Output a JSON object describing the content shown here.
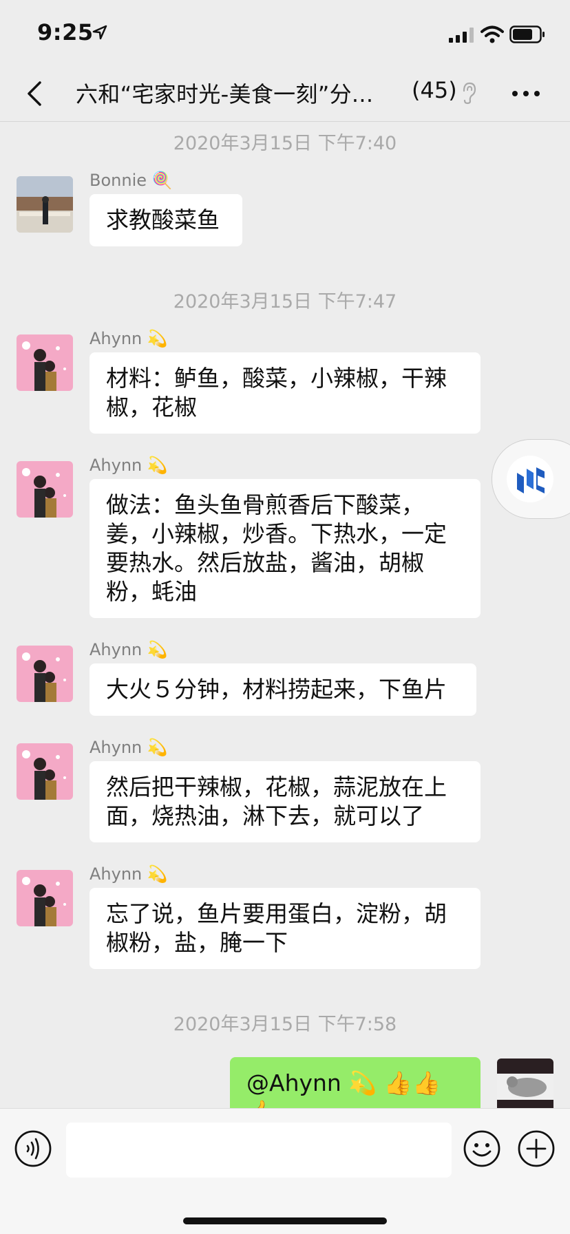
{
  "status_bar": {
    "time": "9:25"
  },
  "nav": {
    "title": "六和“宅家时光-美食一刻”分...",
    "member_count": "(45)"
  },
  "messages": [
    {
      "type": "timestamp",
      "text": "2020年3月15日 下午7:40"
    },
    {
      "type": "text",
      "sender": "Bonnie 🍭",
      "text": "求教酸菜鱼"
    },
    {
      "type": "timestamp",
      "text": "2020年3月15日 下午7:47"
    },
    {
      "type": "text",
      "sender": "Ahynn 💫",
      "text": "材料：鲈鱼，酸菜，小辣椒，干辣椒，花椒"
    },
    {
      "type": "text",
      "sender": "Ahynn 💫",
      "text": "做法：鱼头鱼骨煎香后下酸菜，姜，小辣椒，炒香。下热水，一定要热水。然后放盐，酱油，胡椒粉，蚝油"
    },
    {
      "type": "text",
      "sender": "Ahynn 💫",
      "text": "大火５分钟，材料捞起来，下鱼片"
    },
    {
      "type": "text",
      "sender": "Ahynn 💫",
      "text": "然后把干辣椒，花椒，蒜泥放在上面，烧热油，淋下去，就可以了"
    },
    {
      "type": "text",
      "sender": "Ahynn 💫",
      "text": "忘了说，鱼片要用蛋白，淀粉，胡椒粉，盐，腌一下"
    },
    {
      "type": "timestamp",
      "text": "2020年3月15日 下午7:58"
    },
    {
      "type": "text",
      "sender": "me",
      "text": "@Ahynn 💫 👍👍👍"
    }
  ],
  "input": {
    "placeholder": ""
  },
  "colors": {
    "background": "#ededed",
    "bubble_other": "#ffffff",
    "bubble_self": "#95ec69",
    "timestamp": "#a9a9a9"
  }
}
